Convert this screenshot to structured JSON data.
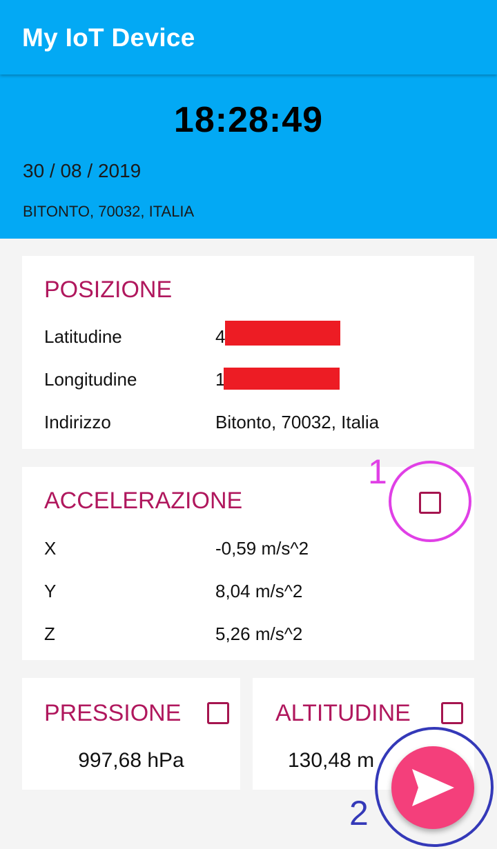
{
  "appbar": {
    "title": "My IoT Device"
  },
  "header": {
    "time": "18:28:49",
    "date": "30 / 08 / 2019",
    "location": "BITONTO, 70032, ITALIA"
  },
  "posizione": {
    "title": "POSIZIONE",
    "rows": [
      {
        "label": "Latitudine",
        "value": "4"
      },
      {
        "label": "Longitudine",
        "value": "1"
      },
      {
        "label": "Indirizzo",
        "value": "Bitonto, 70032, Italia"
      }
    ]
  },
  "accelerazione": {
    "title": "ACCELERAZIONE",
    "rows": [
      {
        "label": "X",
        "value": "-0,59 m/s^2"
      },
      {
        "label": "Y",
        "value": "8,04 m/s^2"
      },
      {
        "label": "Z",
        "value": "5,26 m/s^2"
      }
    ],
    "checked": false
  },
  "pressione": {
    "title": "PRESSIONE",
    "value": "997,68 hPa",
    "checked": false
  },
  "altitudine": {
    "title": "ALTITUDINE",
    "value": "130,48 m",
    "checked": false
  },
  "annotations": {
    "one": "1",
    "two": "2"
  },
  "icons": {
    "send": "send-icon"
  },
  "colors": {
    "primary": "#03a9f4",
    "accent": "#f43f7b",
    "card_title": "#b0175d",
    "redaction": "#ed1c24",
    "annotation_1": "#e040e6",
    "annotation_2": "#3439b8"
  }
}
